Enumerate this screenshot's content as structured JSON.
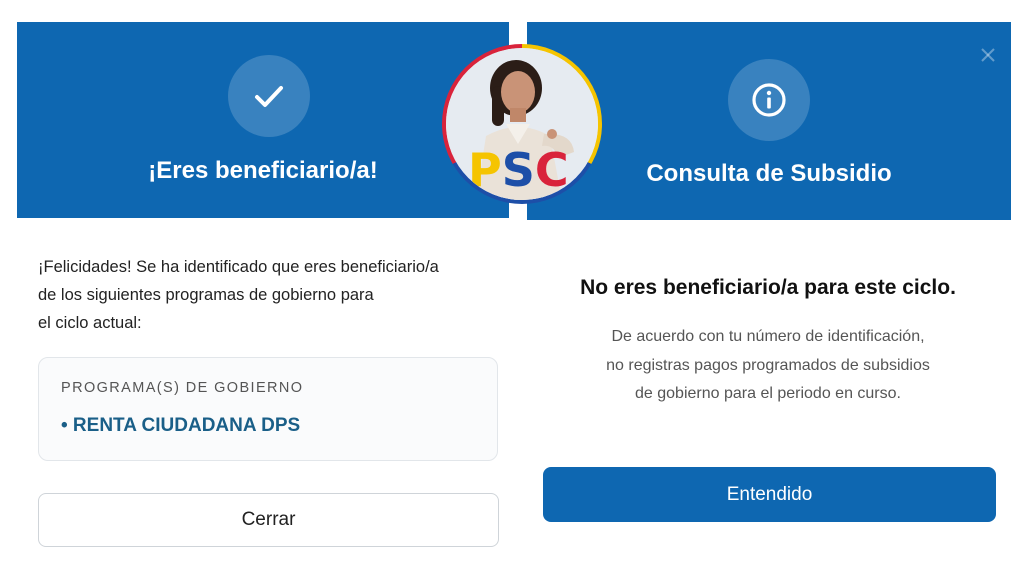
{
  "left_panel": {
    "header_title": "¡Eres beneficiario/a!",
    "intro_lines": [
      "¡Felicidades! Se ha identificado que eres beneficiario/a",
      "de los siguientes programas de gobierno para",
      "el ciclo actual:"
    ],
    "program_card": {
      "label": "PROGRAMA(S) DE GOBIERNO",
      "item": "• RENTA CIUDADANA DPS"
    },
    "close_button_label": "Cerrar"
  },
  "right_panel": {
    "header_title": "Consulta de Subsidio",
    "message_title": "No eres beneficiario/a para este ciclo.",
    "message_lines": [
      "De acuerdo con tu número de identificación,",
      "no registras pagos programados de subsidios",
      "de gobierno para el periodo en curso."
    ],
    "confirm_button_label": "Entendido"
  },
  "avatar": {
    "logo_letters": "PSC"
  },
  "icons": {
    "left_header": "check-icon",
    "right_header": "info-icon",
    "close": "close-icon"
  },
  "colors": {
    "header_blue": "#0e67b1",
    "primary_button": "#0e67b1",
    "program_text": "#1a5f88"
  }
}
